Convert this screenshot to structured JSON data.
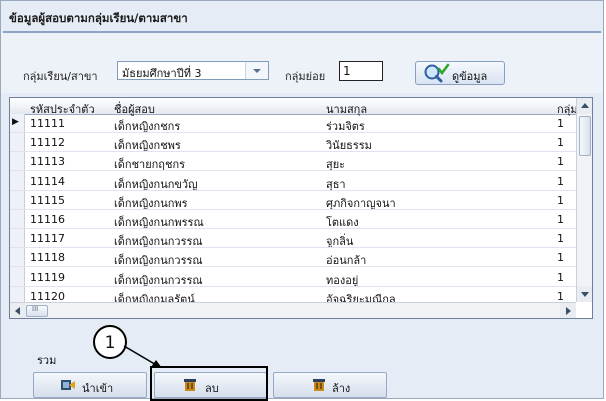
{
  "window": {
    "title": "ข้อมูลผู้สอบตามกลุ่มเรียน/ตามสาขา"
  },
  "filters": {
    "group_label": "กลุ่มเรียน/สาขา",
    "group_value": "มัธยมศึกษาปีที่ 3",
    "subgroup_label": "กลุ่มย่อย",
    "subgroup_value": "1",
    "view_button": "ดูข้อมูล"
  },
  "grid": {
    "columns": [
      "รหัสประจำตัว",
      "ชื่อผู้สอบ",
      "นามสกุล",
      "กลุ่มย่อ"
    ],
    "rows": [
      [
        "11111",
        "เด็กหญิงกชกร",
        "ร่วมจิตร",
        "1"
      ],
      [
        "11112",
        "เด็กหญิงกชพร",
        "วินัยธรรม",
        "1"
      ],
      [
        "11113",
        "เด็กชายกฤชกร",
        "สุยะ",
        "1"
      ],
      [
        "11114",
        "เด็กหญิงกนกขวัญ",
        "สุธา",
        "1"
      ],
      [
        "11115",
        "เด็กหญิงกนกพร",
        "ศุภกิจกาญจนา",
        "1"
      ],
      [
        "11116",
        "เด็กหญิงกนกพรรณ",
        "โตแดง",
        "1"
      ],
      [
        "11117",
        "เด็กหญิงกนกวรรณ",
        "จูกลิ่น",
        "1"
      ],
      [
        "11118",
        "เด็กหญิงกนกวรรณ",
        "อ่อนกล้า",
        "1"
      ],
      [
        "11119",
        "เด็กหญิงกนกวรรณ",
        "ทองอยู่",
        "1"
      ],
      [
        "11120",
        "เด็กหญิงกมลรัตน์",
        "อัจฉริยะมณีกุล",
        "1"
      ]
    ],
    "current_row_marker": "▶",
    "hscroll_thumb_glyph": "III"
  },
  "footer": {
    "total_label": "รวม",
    "import_button": "นำเข้า",
    "delete_button": "ลบ",
    "clear_button": "ล้าง"
  },
  "annotation": {
    "callout_number": "1"
  },
  "colors": {
    "header_rule": "#8ea4c4",
    "panel": "#e6ecf5",
    "grid_border": "#6e7f99"
  }
}
